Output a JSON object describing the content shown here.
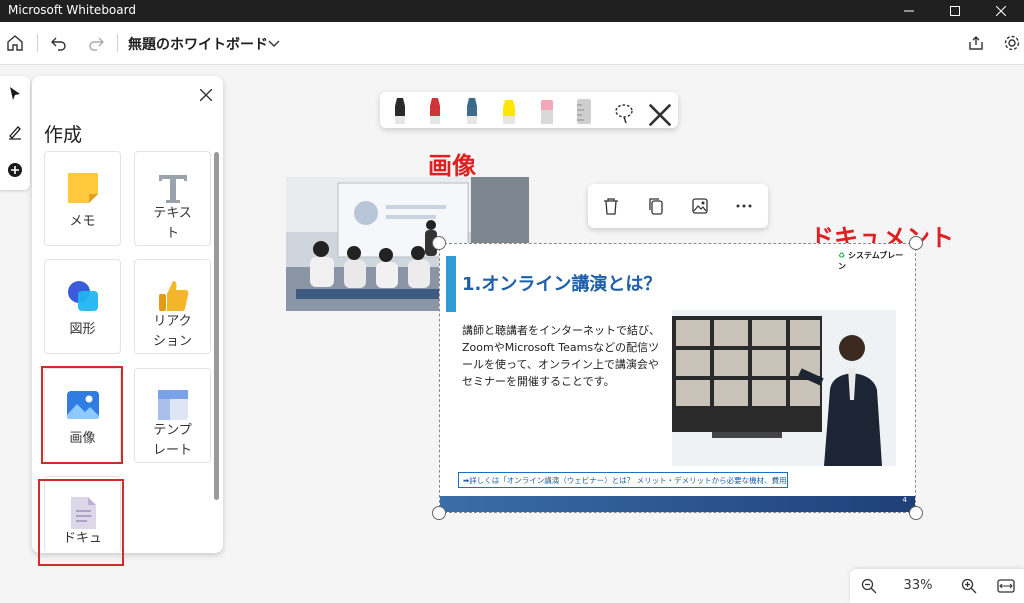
{
  "window": {
    "app_title": "Microsoft Whiteboard"
  },
  "appbar": {
    "board_title": "無題のホワイトボード"
  },
  "create_panel": {
    "title": "作成",
    "tiles": [
      {
        "label": "メモ",
        "icon": "sticky-note-icon"
      },
      {
        "label": "テキスト",
        "icon": "text-icon"
      },
      {
        "label": "図形",
        "icon": "shapes-icon"
      },
      {
        "label": "リアクション",
        "icon": "reaction-icon"
      },
      {
        "label": "画像",
        "icon": "image-icon"
      },
      {
        "label": "テンプレート",
        "icon": "template-icon"
      },
      {
        "label": "ドキュ",
        "icon": "document-icon"
      }
    ]
  },
  "annotations": {
    "image_label": "画像",
    "document_label": "ドキュメント"
  },
  "slide": {
    "title": "1.オンライン講演とは？",
    "body": "講師と聴講者をインターネットで結び、ZoomやMicrosoft Teamsなどの配信ツールを使って、オンライン上で講演会やセミナーを開催することです。",
    "link": "➡詳しくは「オンライン講演（ウェビナー）とは？ メリット・デメリットから必要な機材、費用まで解説」",
    "logo": "システムブレーン",
    "page": "4"
  },
  "zoom": {
    "level": "33%"
  },
  "colors": {
    "annotation_red": "#e02020",
    "slide_blue": "#1d5fa8"
  }
}
